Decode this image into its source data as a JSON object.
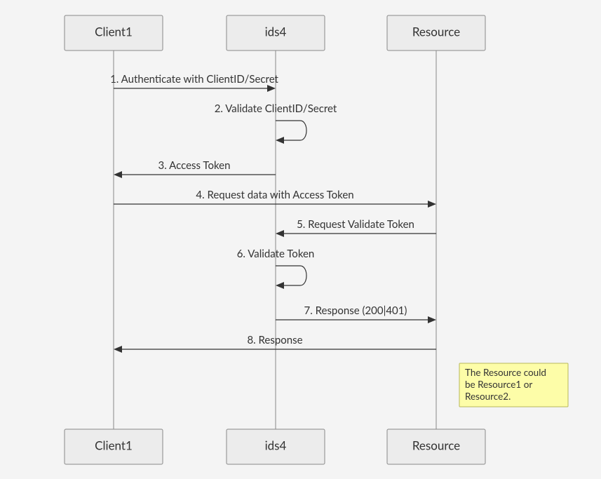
{
  "participants": {
    "p1": "Client1",
    "p2": "ids4",
    "p3": "Resource"
  },
  "messages": {
    "m1": "1. Authenticate with ClientID/Secret",
    "m2": "2. Validate ClientID/Secret",
    "m3": "3. Access Token",
    "m4": "4. Request data with Access Token",
    "m5": "5. Request Validate Token",
    "m6": "6. Validate Token",
    "m7": "7. Response (200|401)",
    "m8": "8. Response"
  },
  "note": {
    "line1": "The Resource could",
    "line2": "be Resource1 or",
    "line3": "Resource2."
  }
}
